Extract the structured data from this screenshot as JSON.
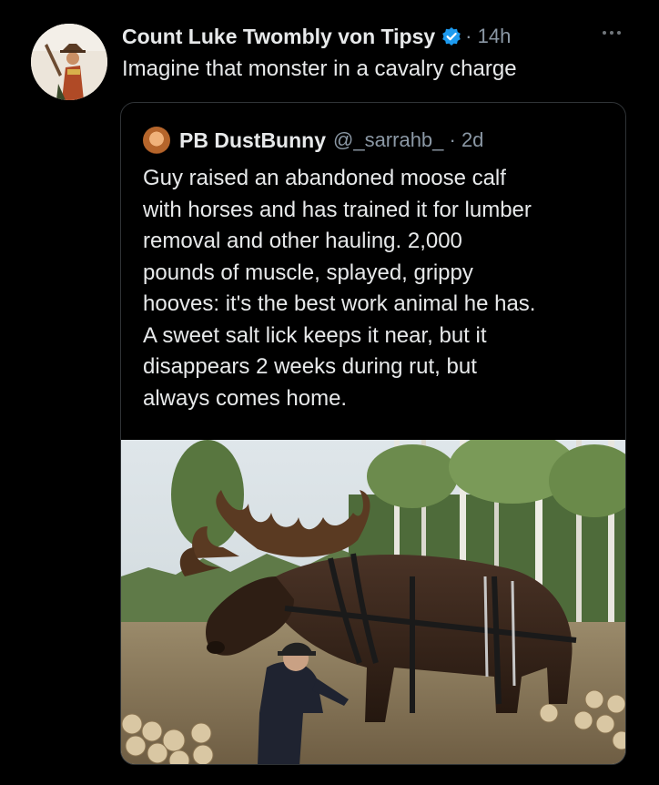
{
  "tweet": {
    "display_name": "Count Luke Twombly von Tipsy",
    "verified_icon": "verified-badge-icon",
    "meta": "· 14h",
    "text": "Imagine that monster in a cavalry charge",
    "more_icon": "more-options-icon"
  },
  "quote": {
    "display_name": "PB DustBunny",
    "meta": "@_sarrahb_ · 2d",
    "lines": [
      "Guy raised an abandoned moose calf",
      "with horses and has trained it for lumber",
      "removal and other hauling. 2,000",
      "pounds of muscle, splayed, grippy",
      "hooves: it's the best work animal he has.",
      "A sweet salt lick keeps it near, but it",
      "disappears 2 weeks during rut,  but",
      "always comes home."
    ]
  },
  "colors": {
    "background": "#000000",
    "text_primary": "#e7e9ea",
    "text_secondary": "#8b98a5",
    "verified_blue": "#1d9bf0",
    "border": "#2f3336"
  }
}
